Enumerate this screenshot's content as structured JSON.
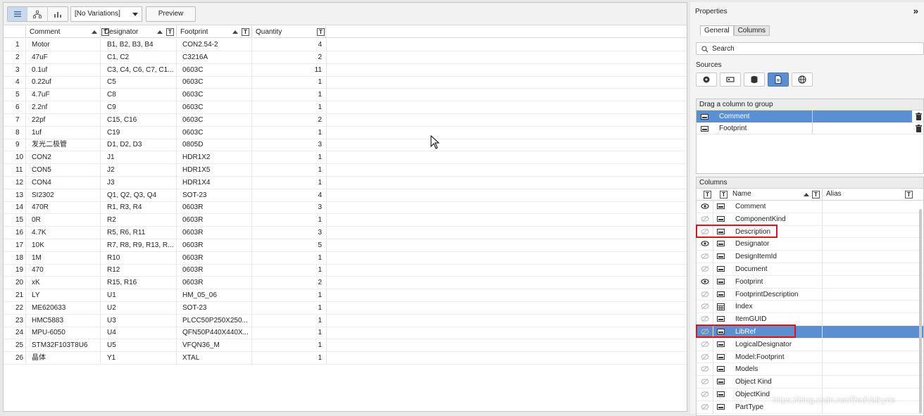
{
  "toolbar": {
    "variation": "[No Variations]",
    "preview": "Preview"
  },
  "bom": {
    "columns": [
      "Comment",
      "Designator",
      "Footprint",
      "Quantity"
    ],
    "rows": [
      [
        "1",
        "Motor",
        "B1, B2, B3, B4",
        "CON2.54-2",
        "4"
      ],
      [
        "2",
        "47uF",
        "C1, C2",
        "C3216A",
        "2"
      ],
      [
        "3",
        "0.1uf",
        "C3, C4, C6, C7, C1...",
        "0603C",
        "11"
      ],
      [
        "4",
        "0.22uf",
        "C5",
        "0603C",
        "1"
      ],
      [
        "5",
        "4.7uF",
        "C8",
        "0603C",
        "1"
      ],
      [
        "6",
        "2.2nf",
        "C9",
        "0603C",
        "1"
      ],
      [
        "7",
        "22pf",
        "C15, C16",
        "0603C",
        "2"
      ],
      [
        "8",
        "1uf",
        "C19",
        "0603C",
        "1"
      ],
      [
        "9",
        "发光二极管",
        "D1, D2, D3",
        "0805D",
        "3"
      ],
      [
        "10",
        "CON2",
        "J1",
        "HDR1X2",
        "1"
      ],
      [
        "11",
        "CON5",
        "J2",
        "HDR1X5",
        "1"
      ],
      [
        "12",
        "CON4",
        "J3",
        "HDR1X4",
        "1"
      ],
      [
        "13",
        "SI2302",
        "Q1, Q2, Q3, Q4",
        "SOT-23",
        "4"
      ],
      [
        "14",
        "470R",
        "R1, R3, R4",
        "0603R",
        "3"
      ],
      [
        "15",
        "0R",
        "R2",
        "0603R",
        "1"
      ],
      [
        "16",
        "4.7K",
        "R5, R6, R11",
        "0603R",
        "3"
      ],
      [
        "17",
        "10K",
        "R7, R8, R9, R13, R...",
        "0603R",
        "5"
      ],
      [
        "18",
        "1M",
        "R10",
        "0603R",
        "1"
      ],
      [
        "19",
        "470",
        "R12",
        "0603R",
        "1"
      ],
      [
        "20",
        "xK",
        "R15, R16",
        "0603R",
        "2"
      ],
      [
        "21",
        "LY",
        "U1",
        "HM_05_06",
        "1"
      ],
      [
        "22",
        "ME620633",
        "U2",
        "SOT-23",
        "1"
      ],
      [
        "23",
        "HMC5883",
        "U3",
        "PLCC50P250X250...",
        "1"
      ],
      [
        "24",
        "MPU-6050",
        "U4",
        "QFN50P440X440X...",
        "1"
      ],
      [
        "25",
        "STM32F103T8U6",
        "U5",
        "VFQN36_M",
        "1"
      ],
      [
        "26",
        "晶体",
        "Y1",
        "XTAL",
        "1"
      ]
    ]
  },
  "properties": {
    "title": "Properties",
    "tabs": [
      "General",
      "Columns"
    ],
    "search_placeholder": "Search",
    "sources_label": "Sources",
    "group_header": "Drag a column to group",
    "group_items": [
      "Comment",
      "Footprint"
    ],
    "columns_header": "Columns",
    "col_name_header": "Name",
    "col_alias_header": "Alias",
    "column_items": [
      {
        "name": "Comment",
        "visible": true
      },
      {
        "name": "ComponentKind",
        "visible": false
      },
      {
        "name": "Description",
        "visible": false
      },
      {
        "name": "Designator",
        "visible": true
      },
      {
        "name": "DesignItemId",
        "visible": false
      },
      {
        "name": "Document",
        "visible": false
      },
      {
        "name": "Footprint",
        "visible": true
      },
      {
        "name": "FootprintDescription",
        "visible": false
      },
      {
        "name": "Index",
        "visible": false
      },
      {
        "name": "ItemGUID",
        "visible": false
      },
      {
        "name": "LibRef",
        "visible": false
      },
      {
        "name": "LogicalDesignator",
        "visible": false
      },
      {
        "name": "Model:Footprint",
        "visible": false
      },
      {
        "name": "Models",
        "visible": false
      },
      {
        "name": "Object Kind",
        "visible": false
      },
      {
        "name": "ObjectKind",
        "visible": false
      },
      {
        "name": "PartType",
        "visible": false
      }
    ]
  },
  "watermark": "https://blog.csdn.net/RedValkyrie"
}
